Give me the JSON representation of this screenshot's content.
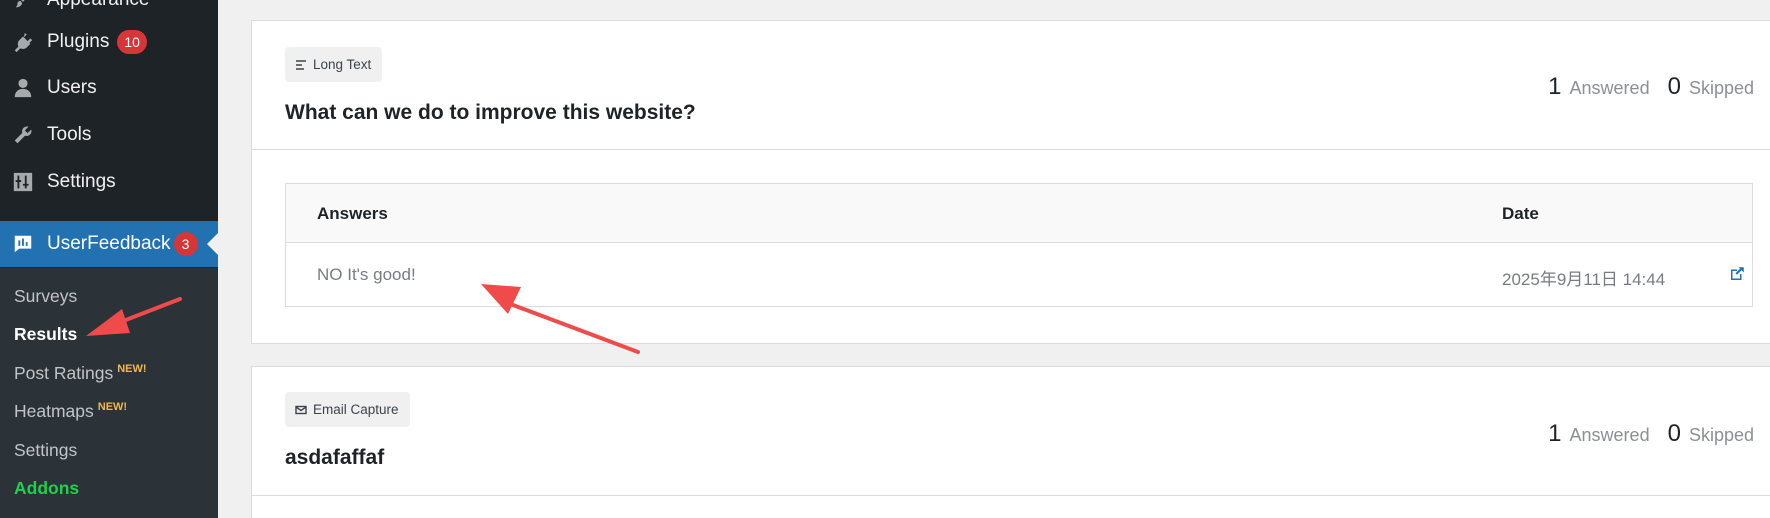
{
  "sidebar": {
    "menu": [
      {
        "label": "Appearance",
        "icon": "paintbrush-icon"
      },
      {
        "label": "Plugins",
        "icon": "plug-icon",
        "badge": "10"
      },
      {
        "label": "Users",
        "icon": "user-icon"
      },
      {
        "label": "Tools",
        "icon": "wrench-icon"
      },
      {
        "label": "Settings",
        "icon": "sliders-icon"
      },
      {
        "label": "UserFeedback",
        "icon": "userfeedback-icon",
        "badge": "3"
      }
    ],
    "submenu": [
      {
        "label": "Surveys"
      },
      {
        "label": "Results"
      },
      {
        "label": "Post Ratings",
        "tag": "NEW!"
      },
      {
        "label": "Heatmaps",
        "tag": "NEW!"
      },
      {
        "label": "Settings"
      },
      {
        "label": "Addons"
      }
    ]
  },
  "cards": [
    {
      "type": "Long Text",
      "type_icon": "text-lines-icon",
      "question": "What can we do to improve this website?",
      "answered_count": "1",
      "answered_label": "Answered",
      "skipped_count": "0",
      "skipped_label": "Skipped",
      "table": {
        "headers": {
          "answers": "Answers",
          "date": "Date"
        },
        "rows": [
          {
            "answer": "NO It's good!",
            "date": "2025年9月11日 14:44"
          }
        ]
      }
    },
    {
      "type": "Email Capture",
      "type_icon": "envelope-icon",
      "question": "asdafaffaf",
      "answered_count": "1",
      "answered_label": "Answered",
      "skipped_count": "0",
      "skipped_label": "Skipped"
    }
  ],
  "colors": {
    "sidebar_bg": "#1d2327",
    "submenu_bg": "#2c3338",
    "active_bg": "#2271b1",
    "badge": "#d63638",
    "new_tag": "#f0b849",
    "addons": "#1ed14b",
    "annotation_arrow": "#f04b4b"
  }
}
